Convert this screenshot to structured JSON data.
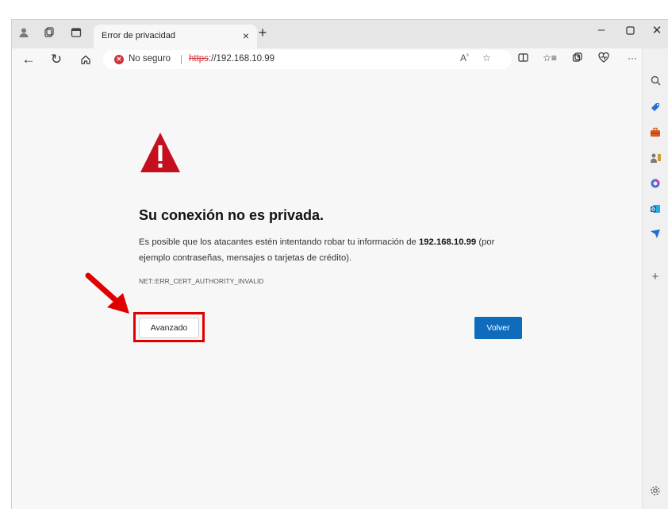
{
  "window": {
    "tab_title": "Error de privacidad",
    "tab_close": "×",
    "new_tab": "+",
    "minimize": "–",
    "maximize": "▢",
    "close": "✕"
  },
  "addressbar": {
    "security_label": "No seguro",
    "separator": "|",
    "url_scheme": "https",
    "url_rest": "://192.168.10.99",
    "more": "···"
  },
  "page": {
    "heading": "Su conexión no es privada.",
    "para_before": "Es posible que los atacantes estén intentando robar tu información de ",
    "para_host": "192.168.10.99",
    "para_after": " (por ejemplo contraseñas, mensajes o tarjetas de crédito).",
    "error_code": "NET::ERR_CERT_AUTHORITY_INVALID",
    "advanced_button": "Avanzado",
    "back_button": "Volver"
  },
  "sidebar": {
    "add": "+"
  },
  "colors": {
    "warning_red": "#c50f1f",
    "primary_blue": "#0f6cbd",
    "highlight_red": "#e00000"
  }
}
